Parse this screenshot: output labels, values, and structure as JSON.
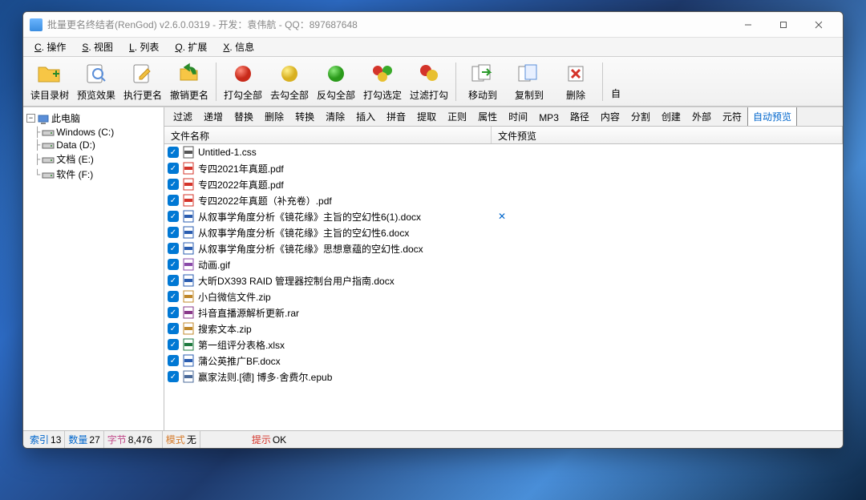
{
  "window": {
    "title": "批量更名终结者(RenGod) v2.6.0.0319 - 开发：袁伟航 - QQ：897687648"
  },
  "menubar": [
    {
      "key": "C",
      "label": "操作"
    },
    {
      "key": "S",
      "label": "视图"
    },
    {
      "key": "L",
      "label": "列表"
    },
    {
      "key": "Q",
      "label": "扩展"
    },
    {
      "key": "X",
      "label": "信息"
    }
  ],
  "toolbar": {
    "read_tree": "读目录树",
    "preview": "预览效果",
    "execute": "执行更名",
    "undo": "撤销更名",
    "check_all": "打勾全部",
    "uncheck_all": "去勾全部",
    "invert": "反勾全部",
    "check_selected": "打勾选定",
    "filter_check": "过滤打勾",
    "move_to": "移动到",
    "copy_to": "复制到",
    "delete": "删除",
    "auto": "自"
  },
  "tree": {
    "root": "此电脑",
    "drives": [
      {
        "label": "Windows (C:)"
      },
      {
        "label": "Data (D:)"
      },
      {
        "label": "文档 (E:)"
      },
      {
        "label": "软件 (F:)"
      }
    ]
  },
  "tabs": [
    "过滤",
    "递增",
    "替换",
    "删除",
    "转换",
    "清除",
    "插入",
    "拼音",
    "提取",
    "正则",
    "属性",
    "时间",
    "MP3",
    "路径",
    "内容",
    "分割",
    "创建",
    "外部",
    "元符",
    "自动预览"
  ],
  "active_tab": 19,
  "columns": {
    "name": "文件名称",
    "preview": "文件预览"
  },
  "files": [
    {
      "name": "Untitled-1.css",
      "type": "css",
      "preview": ""
    },
    {
      "name": "专四2021年真题.pdf",
      "type": "pdf",
      "preview": ""
    },
    {
      "name": "专四2022年真题.pdf",
      "type": "pdf",
      "preview": ""
    },
    {
      "name": "专四2022年真题（补充卷）.pdf",
      "type": "pdf",
      "preview": ""
    },
    {
      "name": "从叙事学角度分析《镜花缘》主旨的空幻性6(1).docx",
      "type": "docx",
      "preview": "✕"
    },
    {
      "name": "从叙事学角度分析《镜花缘》主旨的空幻性6.docx",
      "type": "docx",
      "preview": ""
    },
    {
      "name": "从叙事学角度分析《镜花缘》思想意蕴的空幻性.docx",
      "type": "docx",
      "preview": ""
    },
    {
      "name": "动画.gif",
      "type": "gif",
      "preview": ""
    },
    {
      "name": "大昕DX393 RAID 管理器控制台用户指南.docx",
      "type": "docx",
      "preview": ""
    },
    {
      "name": "小白微信文件.zip",
      "type": "zip",
      "preview": ""
    },
    {
      "name": "抖音直播源解析更新.rar",
      "type": "rar",
      "preview": ""
    },
    {
      "name": "搜索文本.zip",
      "type": "zip",
      "preview": ""
    },
    {
      "name": "第一组评分表格.xlsx",
      "type": "xlsx",
      "preview": ""
    },
    {
      "name": "蒲公英推广BF.docx",
      "type": "docx",
      "preview": ""
    },
    {
      "name": "赢家法则.[德] 博多·舍费尔.epub",
      "type": "epub",
      "preview": ""
    }
  ],
  "status": {
    "index_label": "索引",
    "index_val": "13",
    "count_label": "数量",
    "count_val": "27",
    "bytes_label": "字节",
    "bytes_val": "8,476",
    "mode_label": "模式",
    "mode_val": "无",
    "hint_label": "提示",
    "hint_val": "OK"
  },
  "icon_colors": {
    "pdf": "#d4342a",
    "docx": "#2a5db0",
    "css": "#555",
    "gif": "#8a4aa8",
    "zip": "#c0882a",
    "rar": "#8a3a8a",
    "xlsx": "#1f7a3f",
    "epub": "#4a6a9a"
  }
}
